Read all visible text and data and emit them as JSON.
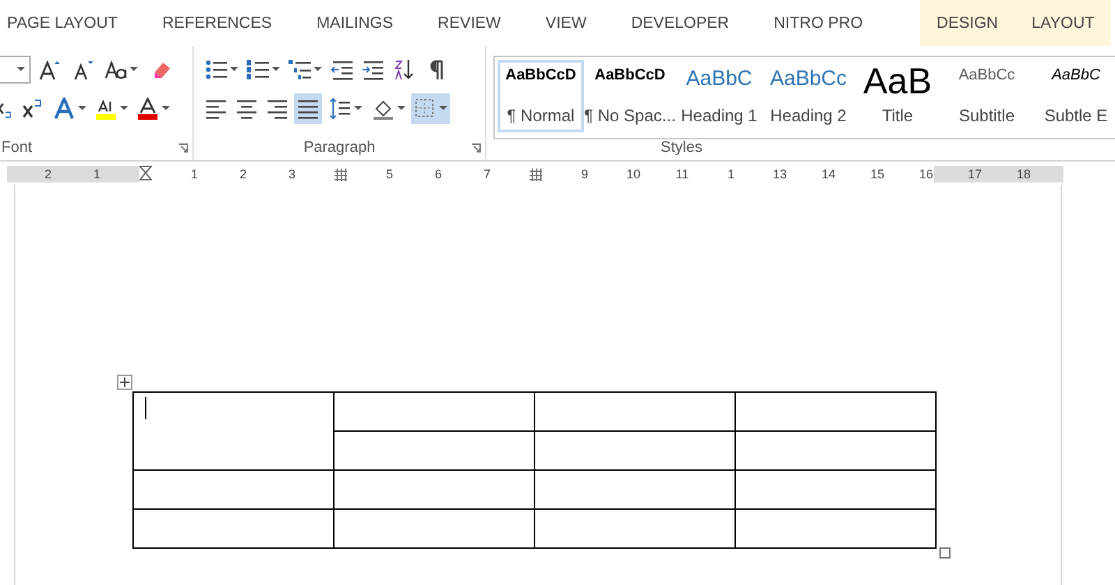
{
  "tabs": [
    {
      "label": "PAGE LAYOUT",
      "contextual": false
    },
    {
      "label": "REFERENCES",
      "contextual": false
    },
    {
      "label": "MAILINGS",
      "contextual": false
    },
    {
      "label": "REVIEW",
      "contextual": false
    },
    {
      "label": "VIEW",
      "contextual": false
    },
    {
      "label": "DEVELOPER",
      "contextual": false
    },
    {
      "label": "NITRO PRO",
      "contextual": false
    },
    {
      "label": "DESIGN",
      "contextual": true
    },
    {
      "label": "LAYOUT",
      "contextual": true
    }
  ],
  "font_group": {
    "label": "Font",
    "buttons": [
      {
        "kind": "size"
      },
      {
        "kind": "grow",
        "selected": false
      },
      {
        "kind": "shrink",
        "selected": false
      },
      {
        "kind": "case",
        "selected": false
      },
      {
        "kind": "clear",
        "selected": false
      },
      {
        "kind": "subscript",
        "selected": false
      },
      {
        "kind": "superscript",
        "selected": false
      },
      {
        "kind": "effects",
        "selected": false
      },
      {
        "kind": "highlight",
        "selected": false
      },
      {
        "kind": "fontcolor",
        "selected": false
      }
    ]
  },
  "paragraph_group": {
    "label": "Paragraph",
    "buttons": [
      {
        "kind": "bullets",
        "selected": false
      },
      {
        "kind": "numbering",
        "selected": false
      },
      {
        "kind": "multilevel",
        "selected": false
      },
      {
        "kind": "outdent",
        "selected": false
      },
      {
        "kind": "indent",
        "selected": false
      },
      {
        "kind": "sort",
        "selected": false
      },
      {
        "kind": "pilcrow",
        "selected": false
      },
      {
        "kind": "left",
        "selected": false
      },
      {
        "kind": "center",
        "selected": false
      },
      {
        "kind": "right",
        "selected": false
      },
      {
        "kind": "justify",
        "selected": true
      },
      {
        "kind": "spacing",
        "selected": false
      },
      {
        "kind": "shading",
        "selected": false
      },
      {
        "kind": "borders",
        "selected": true
      }
    ]
  },
  "styles_group": {
    "label": "Styles",
    "items": [
      {
        "preview": "AaBbCcD",
        "label": "¶ Normal",
        "kind": "normal",
        "selected": true
      },
      {
        "preview": "AaBbCcD",
        "label": "¶ No Spac...",
        "kind": "normal",
        "selected": false
      },
      {
        "preview": "AaBbC",
        "label": "Heading 1",
        "kind": "heading1",
        "selected": false
      },
      {
        "preview": "AaBbCc",
        "label": "Heading 2",
        "kind": "heading2",
        "selected": false
      },
      {
        "preview": "AaB",
        "label": "Title",
        "kind": "title",
        "selected": false
      },
      {
        "preview": "AaBbCc",
        "label": "Subtitle",
        "kind": "subtitle",
        "selected": false
      },
      {
        "preview": "AaBbC",
        "label": "Subtle E",
        "kind": "emphasis",
        "selected": false
      }
    ]
  },
  "ruler": [
    {
      "kind": "number",
      "label": "2"
    },
    {
      "kind": "number",
      "label": "1"
    },
    {
      "kind": "indent"
    },
    {
      "kind": "number",
      "label": "1"
    },
    {
      "kind": "number",
      "label": "2"
    },
    {
      "kind": "number",
      "label": "3"
    },
    {
      "kind": "column"
    },
    {
      "kind": "number",
      "label": "5"
    },
    {
      "kind": "number",
      "label": "6"
    },
    {
      "kind": "number",
      "label": "7"
    },
    {
      "kind": "column"
    },
    {
      "kind": "number",
      "label": "9"
    },
    {
      "kind": "number",
      "label": "10"
    },
    {
      "kind": "number",
      "label": "11"
    },
    {
      "kind": "number",
      "label": "1"
    },
    {
      "kind": "number",
      "label": "13"
    },
    {
      "kind": "number",
      "label": "14"
    },
    {
      "kind": "number",
      "label": "15"
    },
    {
      "kind": "number",
      "label": "16"
    },
    {
      "kind": "number",
      "label": "17"
    },
    {
      "kind": "number",
      "label": "18"
    }
  ],
  "table": {
    "rows": [
      [
        {
          "rowspan": 2,
          "cursor": true
        },
        {
          "cursor": false
        },
        {
          "cursor": false
        },
        {
          "cursor": false
        }
      ],
      [
        {
          "cursor": false
        },
        {
          "cursor": false
        },
        {
          "cursor": false
        }
      ],
      [
        {
          "cursor": false
        },
        {
          "cursor": false
        },
        {
          "cursor": false
        },
        {
          "cursor": false
        }
      ],
      [
        {
          "cursor": false
        },
        {
          "cursor": false
        },
        {
          "cursor": false
        },
        {
          "cursor": false
        }
      ]
    ]
  }
}
